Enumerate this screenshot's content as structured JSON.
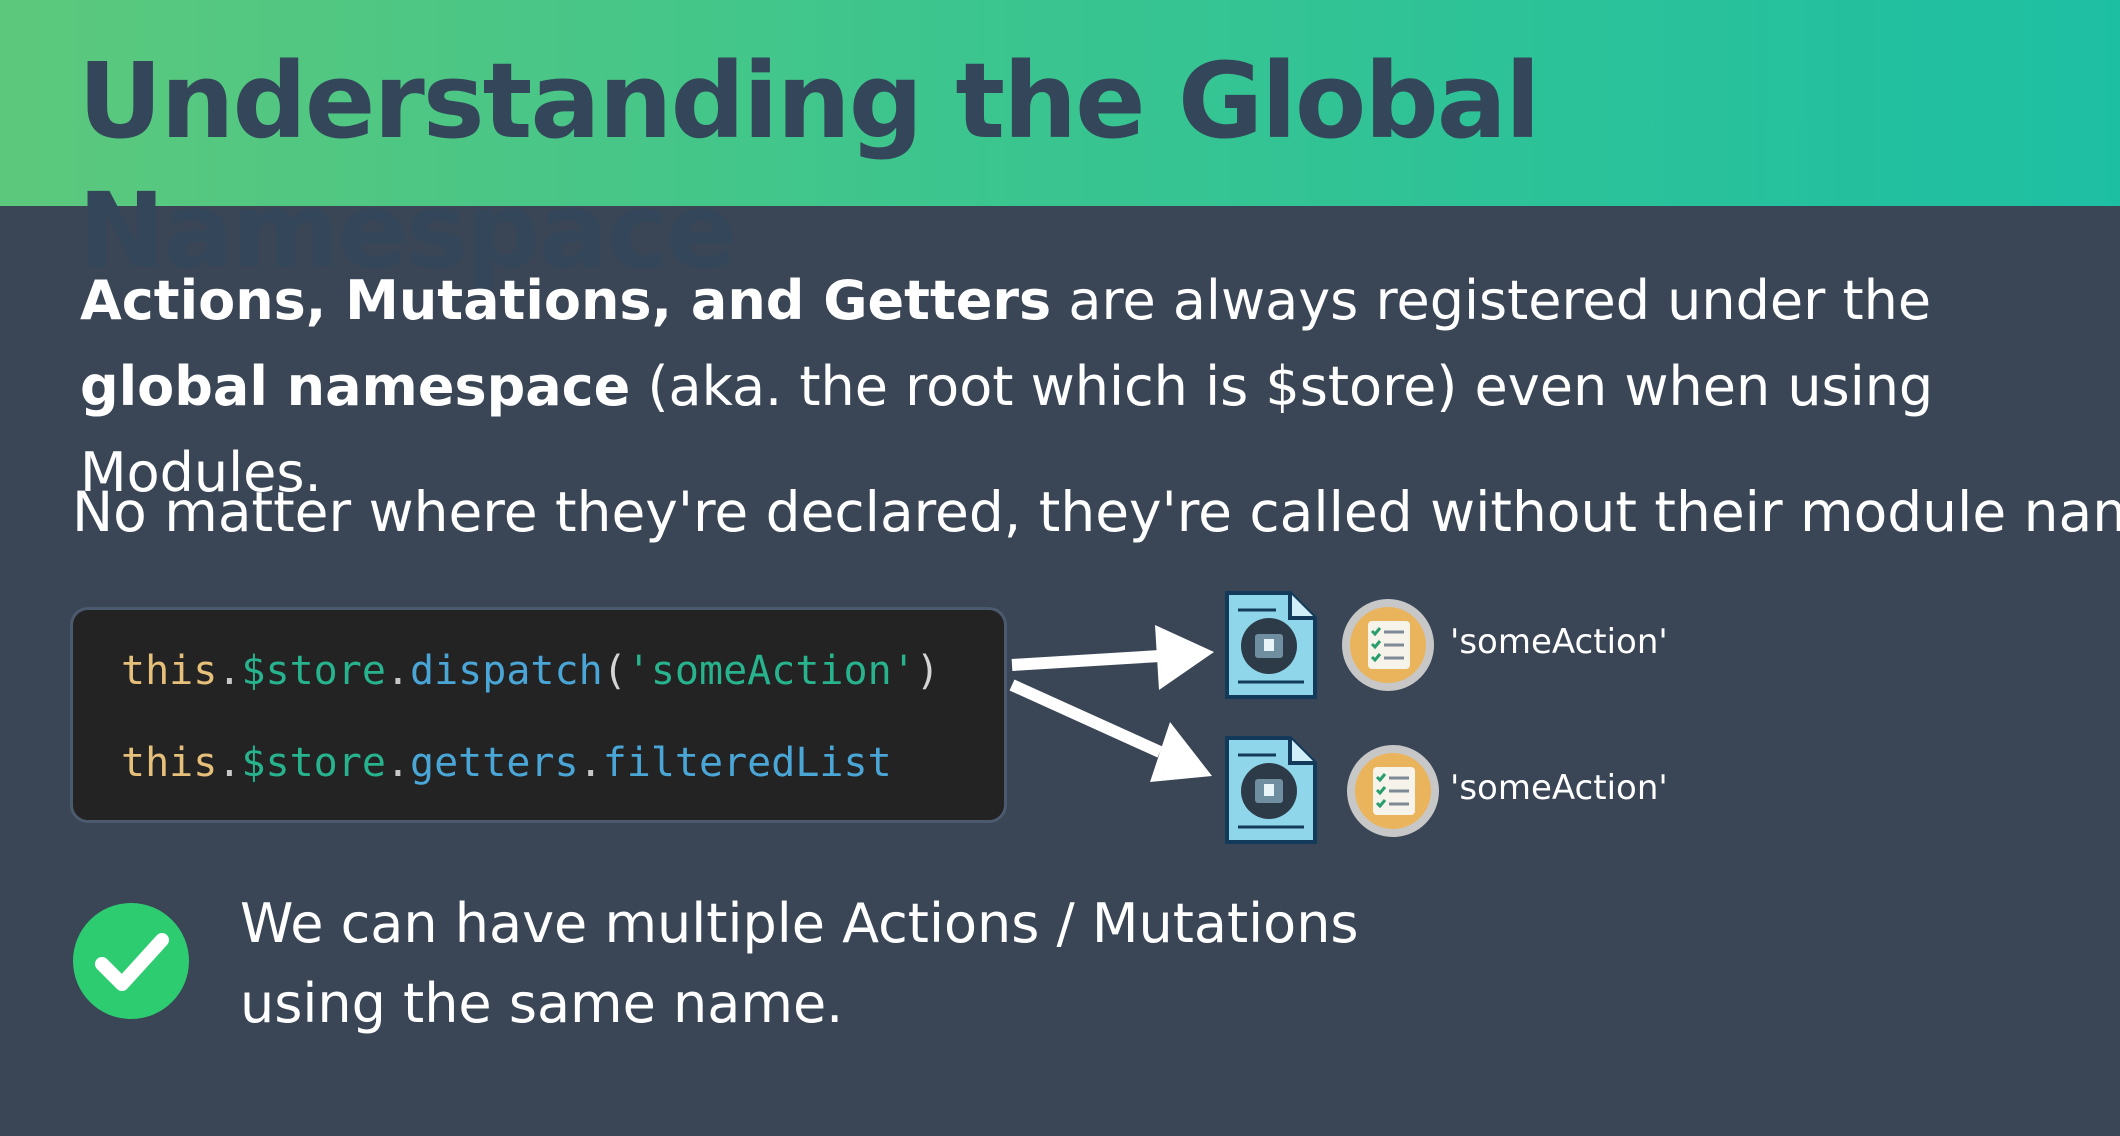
{
  "title": "Understanding the Global Namespace",
  "paragraph1": {
    "bold1": "Actions, Mutations, and Getters",
    "text1": " are always registered under the ",
    "bold2": "global namespace",
    "text2": " (aka. the root which is $store) even when using Modules."
  },
  "paragraph2": "No matter where they're declared, they're called without their module name.",
  "code": {
    "line1": {
      "this": "this",
      "dot1": ".",
      "store": "$store",
      "dot2": ".",
      "method": "dispatch",
      "open": "(",
      "arg": "'someAction'",
      "close": ")"
    },
    "line2": {
      "this": "this",
      "dot1": ".",
      "store": "$store",
      "dot2": ".",
      "prop": "getters",
      "dot3": ".",
      "name": "filteredList"
    }
  },
  "targets": [
    {
      "label": "'someAction'",
      "icon": "file-icon"
    },
    {
      "label": "'someAction'",
      "icon": "file-icon"
    }
  ],
  "bullet": {
    "icon": "checkmark-icon",
    "line1": "We can have multiple Actions / Mutations",
    "line2": "using the same name."
  },
  "colors": {
    "accent": "#2ecc71",
    "header_start": "#5cc87c",
    "header_end": "#1dbfa3",
    "background": "#3a4656"
  }
}
